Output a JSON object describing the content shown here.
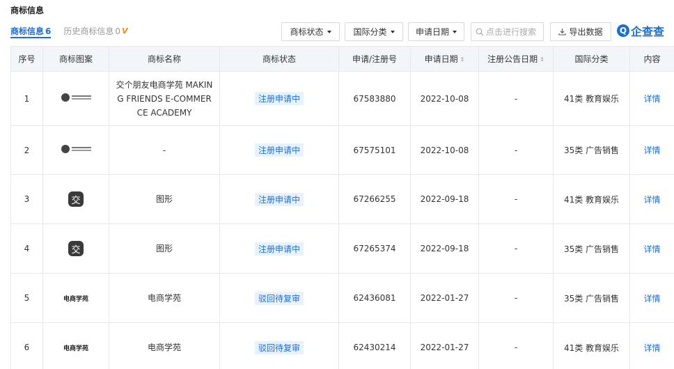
{
  "section_title": "商标信息",
  "tabs": {
    "active_label": "商标信息",
    "active_count": "6",
    "history_label": "历史商标信息",
    "history_count": "0",
    "vip_badge": "V"
  },
  "filters": {
    "status_label": "商标状态",
    "intl_class_label": "国际分类",
    "apply_date_label": "申请日期",
    "search_placeholder": "点击进行搜索",
    "export_label": "导出数据"
  },
  "logo": {
    "icon_letter": "Q",
    "text": "企查查"
  },
  "table": {
    "headers": {
      "index": "序号",
      "image": "商标图案",
      "name": "商标名称",
      "status": "商标状态",
      "reg_no": "申请/注册号",
      "apply_date": "申请日期",
      "announce_date": "注册公告日期",
      "intl_class": "国际分类",
      "content": "内容"
    },
    "rows": [
      {
        "index": "1",
        "image_type": "wide-logo",
        "name": "交个朋友电商学苑 MAKING FRIENDS E-COMMERCE ACADEMY",
        "status": "注册申请中",
        "reg_no": "67583880",
        "apply_date": "2022-10-08",
        "announce_date": "-",
        "intl_class": "41类 教育娱乐",
        "content": "详情"
      },
      {
        "index": "2",
        "image_type": "wide-logo",
        "name": "-",
        "status": "注册申请中",
        "reg_no": "67575101",
        "apply_date": "2022-10-08",
        "announce_date": "-",
        "intl_class": "35类 广告销售",
        "content": "详情"
      },
      {
        "index": "3",
        "image_type": "square-logo",
        "image_glyph": "交",
        "name": "图形",
        "status": "注册申请中",
        "reg_no": "67266255",
        "apply_date": "2022-09-18",
        "announce_date": "-",
        "intl_class": "41类 教育娱乐",
        "content": "详情"
      },
      {
        "index": "4",
        "image_type": "square-logo",
        "image_glyph": "交",
        "name": "图形",
        "status": "注册申请中",
        "reg_no": "67265374",
        "apply_date": "2022-09-18",
        "announce_date": "-",
        "intl_class": "35类 广告销售",
        "content": "详情"
      },
      {
        "index": "5",
        "image_type": "text-logo",
        "image_text": "电商学苑",
        "name": "电商学苑",
        "status": "驳回待复审",
        "reg_no": "62436081",
        "apply_date": "2022-01-27",
        "announce_date": "-",
        "intl_class": "35类 广告销售",
        "content": "详情"
      },
      {
        "index": "6",
        "image_type": "text-logo",
        "image_text": "电商学苑",
        "name": "电商学苑",
        "status": "驳回待复审",
        "reg_no": "62430214",
        "apply_date": "2022-01-27",
        "announce_date": "-",
        "intl_class": "41类 教育娱乐",
        "content": "详情"
      }
    ]
  },
  "colors": {
    "accent": "#1a6ed8",
    "header_bg": "#f2f6fb",
    "tag_bg": "#e8f2fd",
    "vip": "#f08a00"
  }
}
